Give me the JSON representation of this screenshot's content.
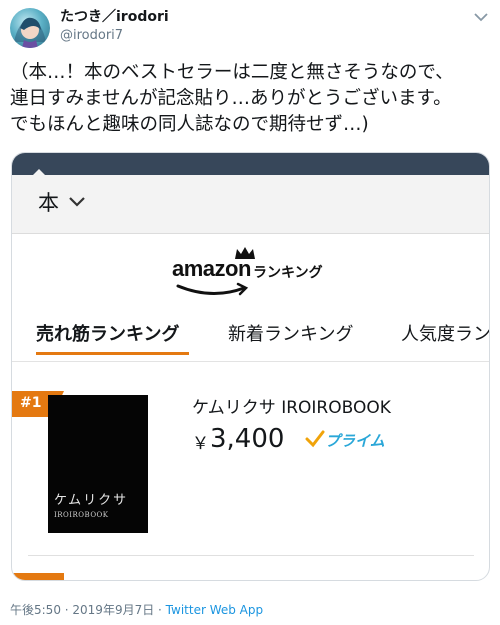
{
  "tweet": {
    "display_name": "たつき／irodori",
    "handle": "@irodori7",
    "text": "（本…！本のベストセラーは二度と無さそうなので、\n連日すみませんが記念貼り…ありがとうございます。\nでもほんと趣味の同人誌なので期待せず…)",
    "time": "午後5:50",
    "date": "2019年9月7日",
    "separator": " · ",
    "client": "Twitter Web App"
  },
  "screenshot": {
    "category": "本",
    "logo": {
      "brand": "amazon",
      "ranking": "ランキング"
    },
    "tabs": [
      {
        "label": "売れ筋ランキング",
        "active": true
      },
      {
        "label": "新着ランキング",
        "active": false
      },
      {
        "label": "人気度ラン",
        "active": false
      }
    ],
    "item": {
      "rank": "#1",
      "title": "ケムリクサ IROIROBOOK",
      "currency": "￥",
      "price": "3,400",
      "prime_label": "プライム",
      "cover_title": "ケムリクサ",
      "cover_subtitle": "IROIROBOOK"
    }
  },
  "colors": {
    "accent_orange": "#e47911",
    "header_dark": "#37475a",
    "prime_blue": "#2aa7d8",
    "link_blue": "#1b95e0"
  },
  "icons": {
    "menu": "chevron-down-icon",
    "category": "chevron-down-icon",
    "prime": "checkmark-icon",
    "crown": "crown-icon"
  }
}
